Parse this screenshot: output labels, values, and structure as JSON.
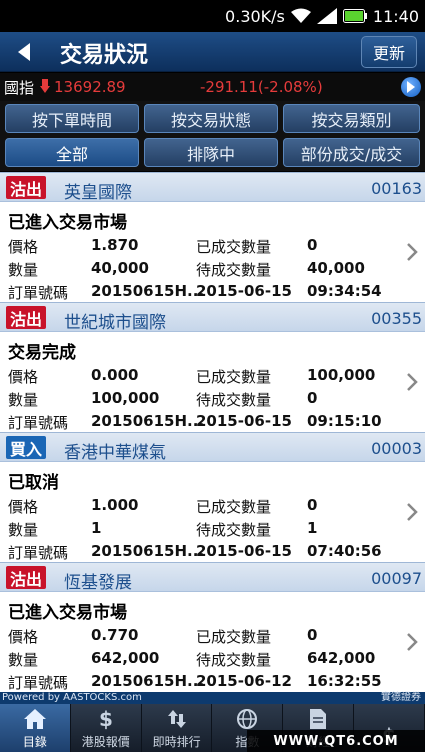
{
  "status_bar": {
    "speed": "0.30K/s",
    "time": "11:40"
  },
  "header": {
    "title": "交易狀況",
    "refresh_label": "更新"
  },
  "index_bar": {
    "label": "國指",
    "value": "13692.89",
    "change": "-291.11(-2.08%)",
    "color": "#e53b3b"
  },
  "filters": {
    "row1": [
      "按下單時間",
      "按交易狀態",
      "按交易類別"
    ],
    "row2": [
      "全部",
      "排隊中",
      "部份成交/成交"
    ]
  },
  "field_labels": {
    "price": "價格",
    "qty": "數量",
    "order_no": "訂單號碼",
    "filled": "已成交數量",
    "pending": "待成交數量"
  },
  "orders": [
    {
      "side": "沽出",
      "side_type": "sell",
      "name": "英皇國際",
      "code": "00163",
      "status": "已進入交易市場",
      "price": "1.870",
      "qty": "40,000",
      "order_no": "20150615H...",
      "filled": "0",
      "pending": "40,000",
      "date": "2015-06-15",
      "time": "09:34:54"
    },
    {
      "side": "沽出",
      "side_type": "sell",
      "name": "世紀城市國際",
      "code": "00355",
      "status": "交易完成",
      "price": "0.000",
      "qty": "100,000",
      "order_no": "20150615H...",
      "filled": "100,000",
      "pending": "0",
      "date": "2015-06-15",
      "time": "09:15:10"
    },
    {
      "side": "買入",
      "side_type": "buy",
      "name": "香港中華煤氣",
      "code": "00003",
      "status": "已取消",
      "price": "1.000",
      "qty": "1",
      "order_no": "20150615H...",
      "filled": "0",
      "pending": "1",
      "date": "2015-06-15",
      "time": "07:40:56"
    },
    {
      "side": "沽出",
      "side_type": "sell",
      "name": "恆基發展",
      "code": "00097",
      "status": "已進入交易市場",
      "price": "0.770",
      "qty": "642,000",
      "order_no": "20150615H...",
      "filled": "0",
      "pending": "642,000",
      "date": "2015-06-12",
      "time": "16:32:55"
    }
  ],
  "powered_by": {
    "left": "Powered by AASTOCKS.com",
    "right": "實德證券"
  },
  "tabs": [
    {
      "label": "目錄",
      "icon": "home-icon",
      "active": true
    },
    {
      "label": "港股報價",
      "icon": "dollar-icon",
      "active": false
    },
    {
      "label": "即時排行",
      "icon": "sort-arrows-icon",
      "active": false
    },
    {
      "label": "指數",
      "icon": "globe-icon",
      "active": false
    },
    {
      "label": "財經",
      "icon": "document-icon",
      "active": false
    },
    {
      "label": "",
      "icon": "dollar-icon",
      "active": false
    }
  ],
  "watermark": "WWW.QT6.COM"
}
